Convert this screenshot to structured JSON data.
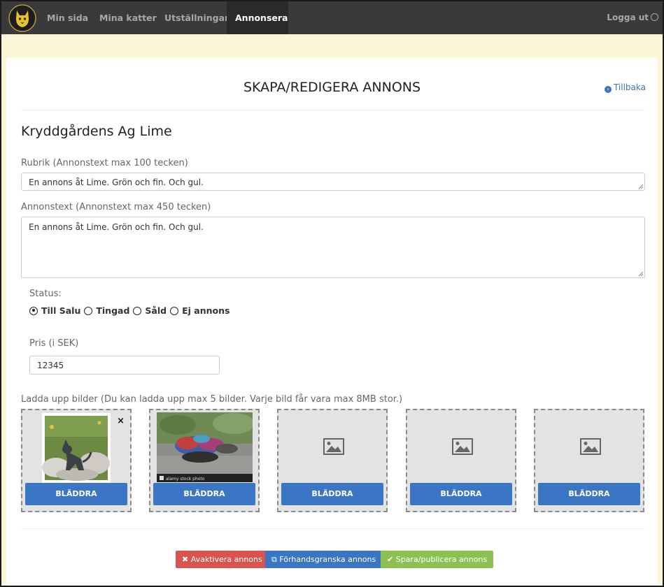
{
  "nav": {
    "items": [
      "Min sida",
      "Mina katter",
      "Utställningar",
      "Annonsera"
    ],
    "active": "Annonsera",
    "logout": "Logga ut"
  },
  "header": {
    "title": "SKAPA/REDIGERA ANNONS",
    "back": "Tillbaka"
  },
  "cat_name": "Kryddgårdens Ag Lime",
  "headline": {
    "label": "Rubrik (Annonstext max 100 tecken)",
    "value": "En annons åt Lime. Grön och fin. Och gul."
  },
  "adtext": {
    "label": "Annonstext (Annonstext max 450 tecken)",
    "value": "En annons åt Lime. Grön och fin. Och gul."
  },
  "status": {
    "label": "Status:",
    "options": [
      "Till Salu",
      "Tingad",
      "Såld",
      "Ej annons"
    ],
    "selected": "Till Salu"
  },
  "price": {
    "label": "Pris (i SEK)",
    "value": "12345"
  },
  "upload": {
    "label": "Ladda upp bilder (Du kan ladda upp max 5 bilder. Varje bild får vara max 8MB stor.)",
    "browse": "BLÄDDRA",
    "remove_symbol": "×",
    "stock_caption": "alamy stock photo"
  },
  "actions": {
    "deactivate": "Avaktivera annons",
    "preview": "Förhandsgranska annons",
    "save": "Spara/publicera annons"
  },
  "colors": {
    "navbar": "#3a3a3a",
    "band": "#fcf5d6",
    "primary": "#3a76c4",
    "danger": "#d9534f",
    "success": "#8cc152"
  }
}
